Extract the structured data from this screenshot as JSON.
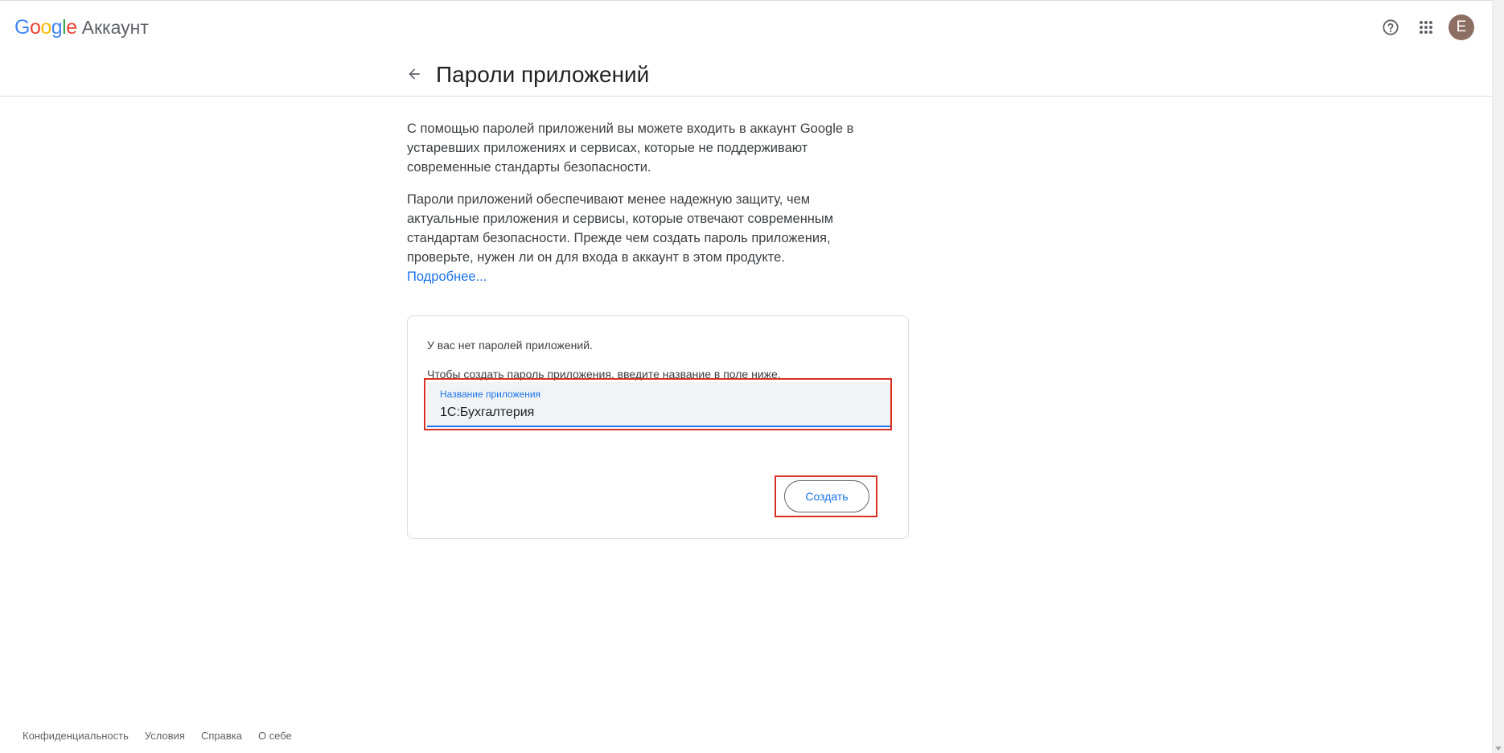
{
  "header": {
    "logo_google": [
      "G",
      "o",
      "o",
      "g",
      "l",
      "e"
    ],
    "logo_product": "Аккаунт",
    "help_icon": "help-circle-icon",
    "apps_icon": "apps-grid-icon",
    "avatar_initial": "Е"
  },
  "title_bar": {
    "back_icon": "arrow-left-icon",
    "title": "Пароли приложений"
  },
  "content": {
    "para1": "С помощью паролей приложений вы можете входить в аккаунт Google в устаревших приложениях и сервисах, которые не поддерживают современные стандарты безопасности.",
    "para2": "Пароли приложений обеспечивают менее надежную защиту, чем актуальные приложения и сервисы, которые отвечают современным стандартам безопасности. Прежде чем создать пароль приложения, проверьте, нужен ли он для входа в аккаунт в этом продукте.",
    "learn_more": "Подробнее..."
  },
  "card": {
    "no_passwords": "У вас нет паролей приложений.",
    "instruction": "Чтобы создать пароль приложения, введите название в поле ниже.",
    "input_label": "Название приложения",
    "input_value": "1С:Бухгалтерия",
    "create_button": "Создать"
  },
  "footer": {
    "links": [
      "Конфиденциальность",
      "Условия",
      "Справка",
      "О себе"
    ]
  },
  "colors": {
    "accent": "#1a73e8",
    "highlight": "#d93025",
    "avatar_bg": "#8d6e63"
  }
}
